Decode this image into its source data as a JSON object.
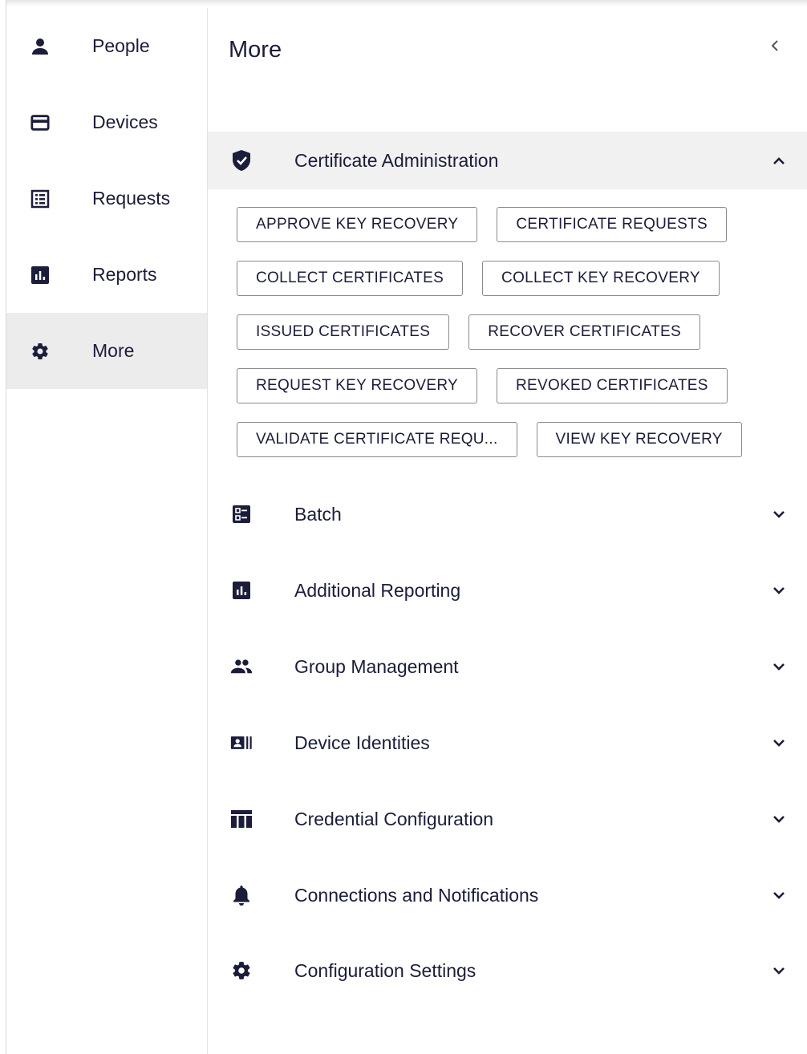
{
  "sidebar": {
    "items": [
      {
        "label": "People",
        "icon": "person-icon"
      },
      {
        "label": "Devices",
        "icon": "credit-card-icon"
      },
      {
        "label": "Requests",
        "icon": "list-box-icon"
      },
      {
        "label": "Reports",
        "icon": "bar-chart-icon"
      },
      {
        "label": "More",
        "icon": "gear-icon",
        "active": true
      }
    ]
  },
  "main": {
    "title": "More",
    "collapse_icon": "chevron-left-icon",
    "sections": [
      {
        "label": "Certificate Administration",
        "icon": "shield-check-icon",
        "expanded": true,
        "actions": [
          "APPROVE KEY RECOVERY",
          "CERTIFICATE REQUESTS",
          "COLLECT CERTIFICATES",
          "COLLECT KEY RECOVERY",
          "ISSUED CERTIFICATES",
          "RECOVER CERTIFICATES",
          "REQUEST KEY RECOVERY",
          "REVOKED CERTIFICATES",
          "VALIDATE CERTIFICATE REQU...",
          "VIEW KEY RECOVERY"
        ]
      },
      {
        "label": "Batch",
        "icon": "batch-list-icon",
        "expanded": false
      },
      {
        "label": "Additional Reporting",
        "icon": "bar-chart-icon",
        "expanded": false
      },
      {
        "label": "Group Management",
        "icon": "group-icon",
        "expanded": false
      },
      {
        "label": "Device Identities",
        "icon": "badge-icon",
        "expanded": false
      },
      {
        "label": "Credential Configuration",
        "icon": "table-icon",
        "expanded": false
      },
      {
        "label": "Connections and Notifications",
        "icon": "bell-icon",
        "expanded": false
      },
      {
        "label": "Configuration Settings",
        "icon": "gear-icon",
        "expanded": false
      }
    ]
  },
  "colors": {
    "ink": "#1b1d3a",
    "active_bg": "#ececec",
    "section_open_bg": "#f1f1f1",
    "chip_border": "#8a8a8a"
  }
}
